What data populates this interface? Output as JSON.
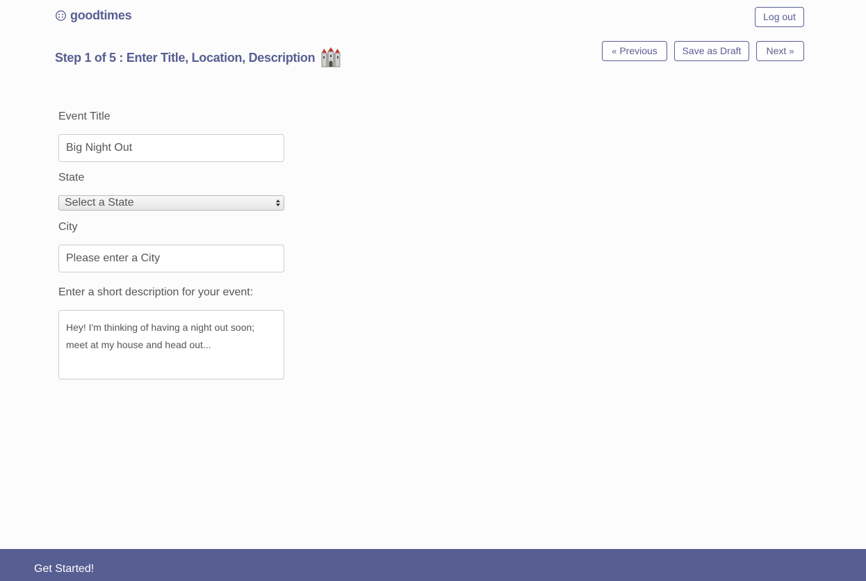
{
  "header": {
    "brand_name": "goodtimes",
    "logout_label": "Log out"
  },
  "wizard": {
    "step_title": "Step 1 of 5 : Enter Title, Location, Description",
    "previous_label": "Previous",
    "save_draft_label": "Save as Draft",
    "next_label": "Next"
  },
  "form": {
    "event_title_label": "Event Title",
    "event_title_value": "Big Night Out",
    "state_label": "State",
    "state_selected": "Select a State",
    "city_label": "City",
    "city_placeholder": "Please enter a City",
    "description_label": "Enter a short description for your event:",
    "description_value": "Hey! I'm thinking of having a night out soon; meet at my house and head out..."
  },
  "footer": {
    "get_started_label": "Get Started!"
  },
  "colors": {
    "brand": "#575e92",
    "text": "#555555",
    "background": "#fcfcfc"
  },
  "icons": {
    "brand_icon": "smiley-icon",
    "step_icon": "castle-icon",
    "previous_icon": "double-chevron-left-icon",
    "next_icon": "double-chevron-right-icon",
    "select_icon": "select-arrows-icon"
  }
}
